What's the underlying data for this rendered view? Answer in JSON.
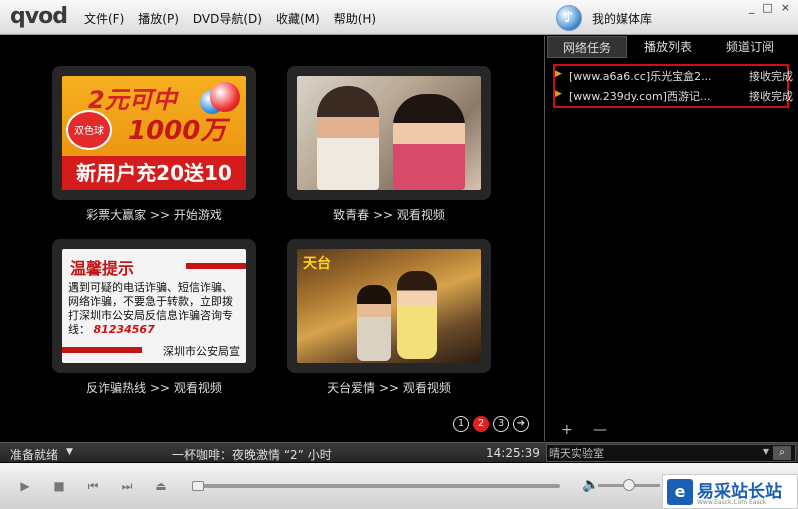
{
  "app": {
    "logo": "qvod",
    "menu": [
      "文件(F)",
      "播放(P)",
      "DVD导航(D)",
      "收藏(M)",
      "帮助(H)"
    ],
    "media_library": "我的媒体库",
    "window_controls": [
      "_",
      "□",
      "×"
    ]
  },
  "main": {
    "cards": [
      {
        "caption": "彩票大赢家 >> 开始游戏",
        "image": {
          "line1": "2元可中",
          "line2": "1000万",
          "banner": "新用户充20送10",
          "badge": "双色球"
        }
      },
      {
        "caption": "致青春 >> 观看视频",
        "image": {}
      },
      {
        "caption": "反诈骗热线 >> 观看视频",
        "image": {
          "title": "温馨提示",
          "body": "遇到可疑的电话诈骗、短信诈骗、网络诈骗，不要急于转款，立即拨打深圳市公安局反信息诈骗咨询专线：",
          "hotline": "81234567",
          "sign": "深圳市公安局宣"
        }
      },
      {
        "caption": "天台爱情 >> 观看视频",
        "image": {
          "title": "天台"
        }
      }
    ],
    "pager": {
      "pages": [
        "1",
        "2",
        "3"
      ],
      "active": 2,
      "next_icon": "➔"
    }
  },
  "panel": {
    "tabs": [
      "网络任务",
      "播放列表",
      "频道订阅"
    ],
    "active_tab": 0,
    "tasks": [
      {
        "name": "[www.a6a6.cc]乐光宝盒2...",
        "status": "接收完成"
      },
      {
        "name": "[www.239dy.com]西游记...",
        "status": "接收完成"
      }
    ],
    "footer": {
      "add": "+",
      "remove": "—"
    }
  },
  "status": {
    "ready": "准备就绪",
    "now_playing": "一杯咖啡：夜晚激情 “2” 小时",
    "time": "14:25:39",
    "search_value": "晴天实验室"
  },
  "controls": {
    "buttons": [
      "▶",
      "■",
      "⏮",
      "⏭",
      "⏏"
    ],
    "progress": 0.0,
    "volume": 0.5
  },
  "watermark": {
    "text": "易采站长站",
    "sub": "Www.Easck.Com Easck"
  }
}
